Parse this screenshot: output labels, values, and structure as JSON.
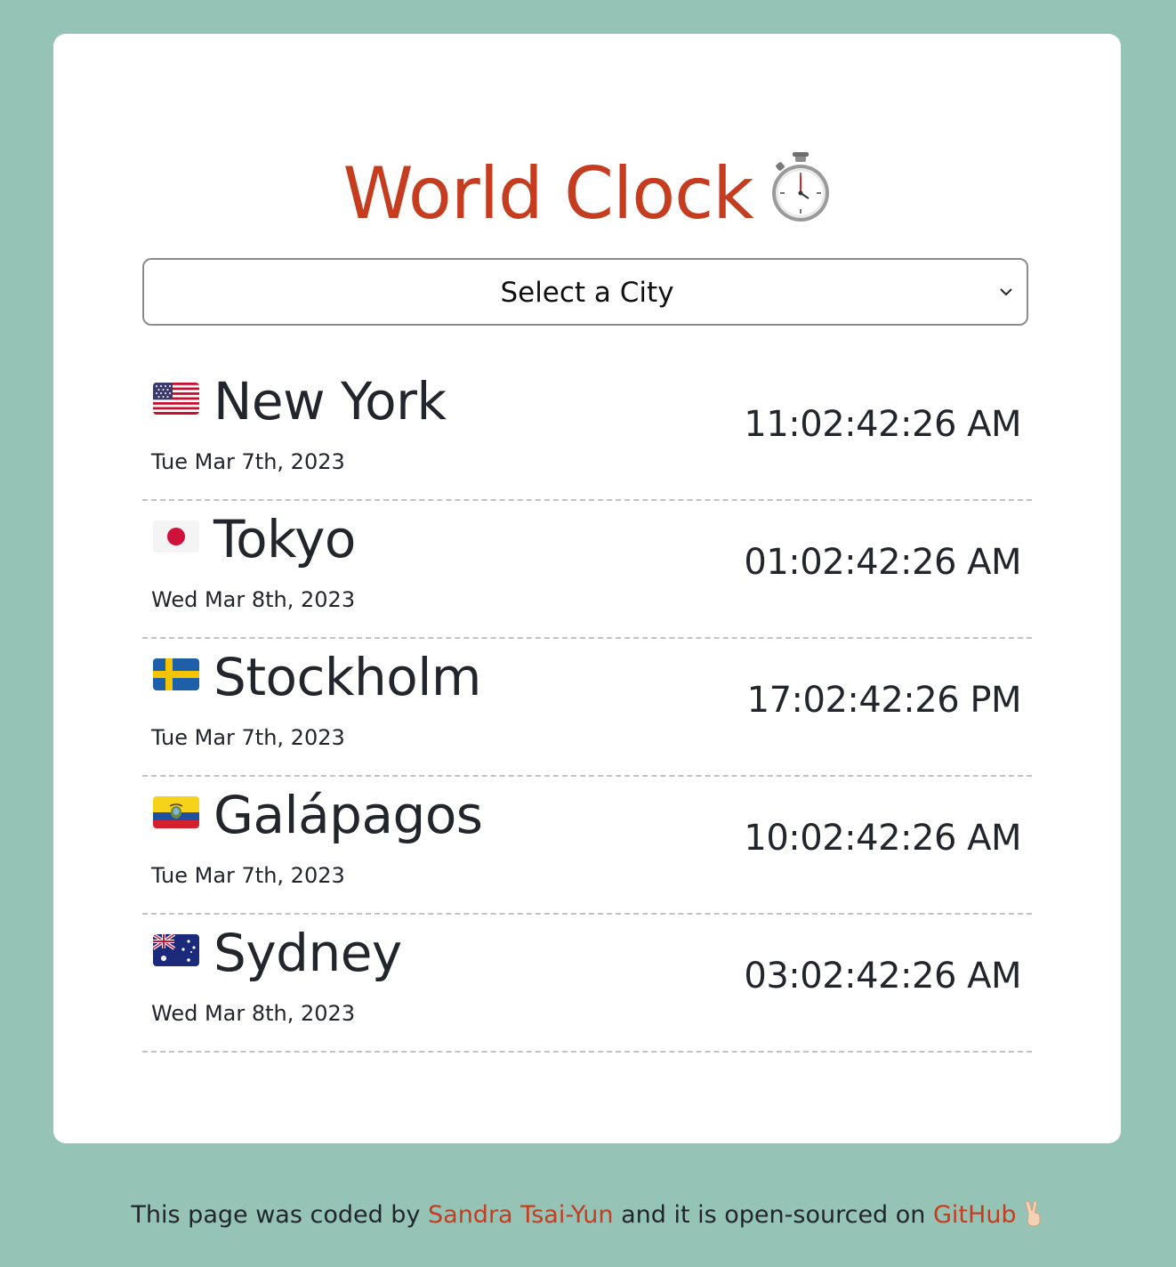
{
  "header": {
    "title": "World Clock",
    "title_icon": "stopwatch-icon"
  },
  "city_select": {
    "selected": "Select a City",
    "icon": "chevron-down-icon"
  },
  "cities": [
    {
      "flag": "us-flag-icon",
      "name": "New York",
      "date": "Tue Mar 7th, 2023",
      "time": "11:02:42:26 AM"
    },
    {
      "flag": "japan-flag-icon",
      "name": "Tokyo",
      "date": "Wed Mar 8th, 2023",
      "time": "01:02:42:26 AM"
    },
    {
      "flag": "sweden-flag-icon",
      "name": "Stockholm",
      "date": "Tue Mar 7th, 2023",
      "time": "17:02:42:26 PM"
    },
    {
      "flag": "ecuador-flag-icon",
      "name": "Galápagos",
      "date": "Tue Mar 7th, 2023",
      "time": "10:02:42:26 AM"
    },
    {
      "flag": "australia-flag-icon",
      "name": "Sydney",
      "date": "Wed Mar 8th, 2023",
      "time": "03:02:42:26 AM"
    }
  ],
  "footer": {
    "text_before": "This page was coded by ",
    "author_link": "Sandra Tsai-Yun",
    "text_middle": " and it is open-sourced on ",
    "github_link": "GitHub",
    "end_icon": "peace-hand-icon"
  },
  "colors": {
    "background": "#95c4b6",
    "card": "#ffffff",
    "accent": "#c53c1f",
    "text": "#22252b"
  }
}
